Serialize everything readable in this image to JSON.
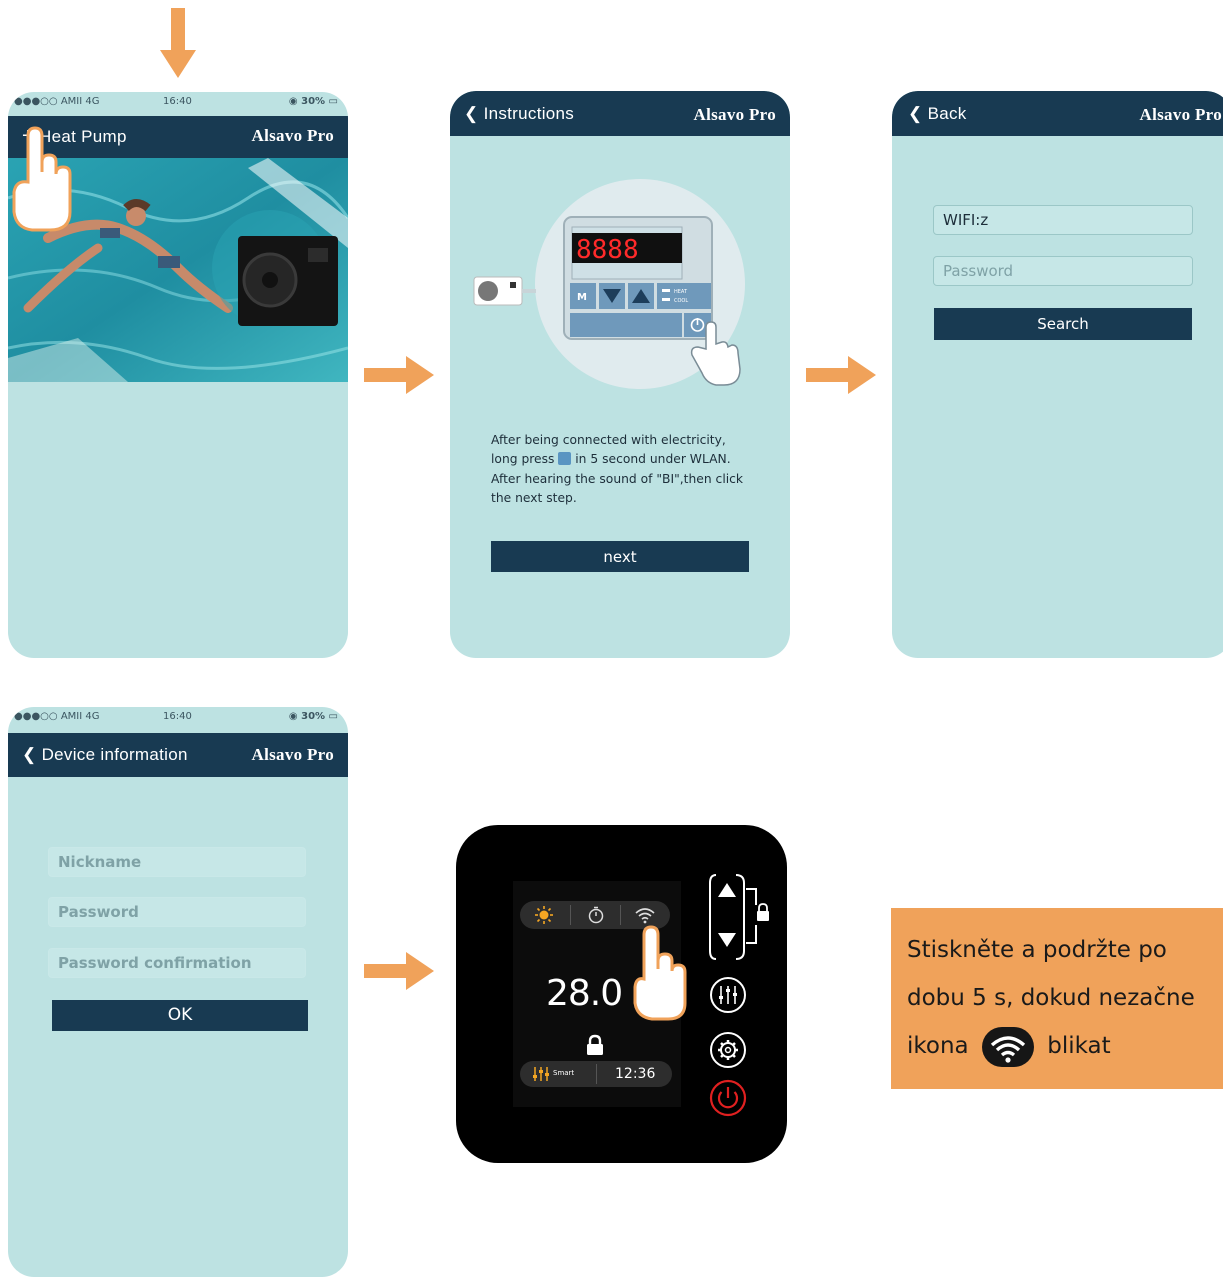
{
  "brand": "Alsavo Pro",
  "status_bar": {
    "carrier": "AMII 4G",
    "time": "16:40",
    "battery": "30%"
  },
  "screen1": {
    "title": "Heat Pump"
  },
  "screen2": {
    "back_label": "Instructions",
    "display": "8888",
    "instruction_lines": [
      "After being connected with electricity,",
      "long press",
      "in 5 second under WLAN.",
      "After hearing the sound of \"BI\",then click",
      "the next step."
    ],
    "next_button": "next",
    "panel_labels": {
      "mode": "M",
      "heat": "HEAT",
      "cool": "COOL"
    }
  },
  "screen3": {
    "back_label": "Back",
    "wifi_value": "WIFI:z",
    "password_placeholder": "Password",
    "search_button": "Search"
  },
  "screen4": {
    "title": "Device information",
    "nickname_placeholder": "Nickname",
    "password_placeholder": "Password",
    "confirm_placeholder": "Password confirmation",
    "ok_button": "OK"
  },
  "controller": {
    "temperature": "28.0",
    "mode": "Smart",
    "clock": "12:36"
  },
  "instruction_box": {
    "line1": "Stiskněte a podržte po",
    "line2": "dobu 5 s, dokud nezačne",
    "line3_start": "ikona",
    "line3_end": "blikat"
  },
  "colors": {
    "accent_orange": "#f0a25a",
    "navy": "#183a52",
    "phone_bg": "#bde2e2"
  }
}
